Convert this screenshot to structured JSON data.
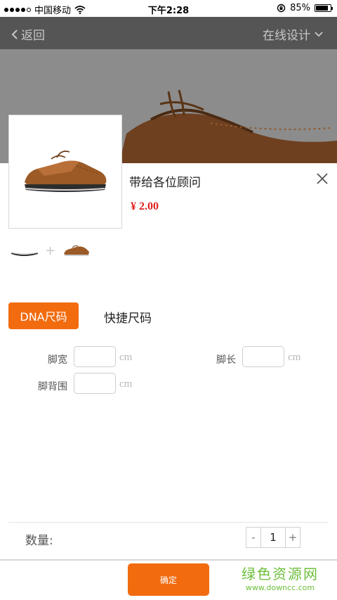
{
  "status_bar": {
    "carrier": "中国移动",
    "time": "下午2:28",
    "battery_percent": "85%",
    "battery_level": 0.85
  },
  "nav": {
    "back_label": "返回",
    "design_label": "在线设计"
  },
  "product": {
    "name": "带给各位顾问",
    "price": "¥ 2.00"
  },
  "tabs": {
    "dna_label": "DNA尺码",
    "quick_label": "快捷尺码"
  },
  "size_fields": {
    "width_label": "脚宽",
    "length_label": "脚长",
    "girth_label": "脚背围",
    "unit": "cm"
  },
  "quantity": {
    "label": "数量:",
    "minus": "-",
    "value": "1",
    "plus": "+"
  },
  "confirm_label": "确定",
  "watermark": {
    "title": "绿色资源网",
    "url": "www.downcc.com"
  },
  "colors": {
    "accent": "#f26b0f",
    "price": "#e02020",
    "nav_bg": "#555555"
  }
}
